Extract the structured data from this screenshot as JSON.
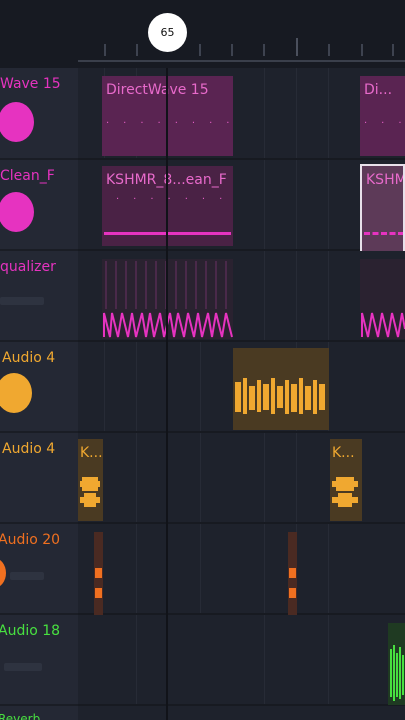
{
  "timeline": {
    "playhead_label": "65"
  },
  "colors": {
    "pink": "#e633c0",
    "orange": "#f0a830",
    "green": "#48e040",
    "orange_red": "#f07020"
  },
  "tracks": [
    {
      "name": "Wave 15",
      "color": "#e633c0"
    },
    {
      "name": "Clean_F",
      "color": "#e633c0"
    },
    {
      "name": "qualizer",
      "color": "#e633c0"
    },
    {
      "name": "Audio 4",
      "color": "#f0a830"
    },
    {
      "name": "Audio 4",
      "color": "#f0a830"
    },
    {
      "name": "Audio 20",
      "color": "#f07020"
    },
    {
      "name": "Audio 18",
      "color": "#48e040"
    },
    {
      "name": "Reverb",
      "color": "#48e040"
    }
  ],
  "clips": {
    "directwave_1": "DirectWave 15",
    "directwave_2": "Di...",
    "kshmr_1": "KSHMR_8...ean_F",
    "kshmr_2": "KSHMR",
    "audio4_a": "K...",
    "audio4_b": "K..."
  }
}
